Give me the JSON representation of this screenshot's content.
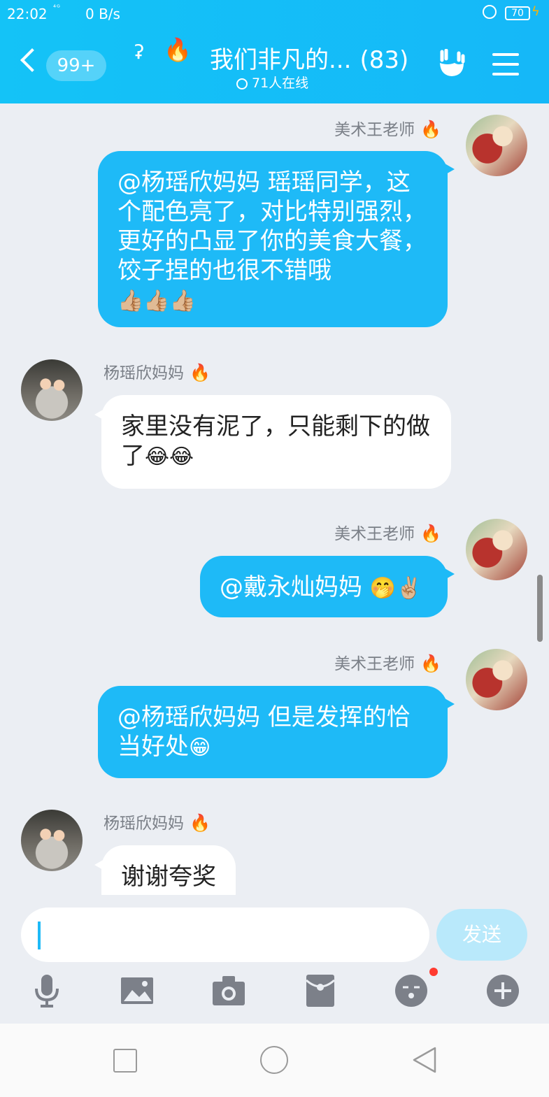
{
  "status_bar": {
    "time": "22:02",
    "signal": "⁴ᴳ",
    "net_speed": "0 B/s",
    "battery": "70"
  },
  "header": {
    "back_badge": "99+",
    "title": "我们非凡的...",
    "member_count": "(83)",
    "online": "71人在线"
  },
  "messages": [
    {
      "sender": "美术王老师",
      "text": "@杨瑶欣妈妈 瑶瑶同学，这个配色亮了，对比特别强烈，更好的凸显了你的美食大餐，饺子捏的也很不错哦",
      "emoji": "👍🏼👍🏼👍🏼"
    },
    {
      "sender": "杨瑶欣妈妈",
      "text": "家里没有泥了，只能剩下的做了",
      "emoji": "😂😂"
    },
    {
      "sender": "美术王老师",
      "text": "@戴永灿妈妈 ",
      "emoji": "🤭✌🏼"
    },
    {
      "sender": "美术王老师",
      "text": "@杨瑶欣妈妈 但是发挥的恰当好处",
      "emoji": "😁"
    },
    {
      "sender": "杨瑶欣妈妈",
      "text": "谢谢夸奖",
      "emoji": ""
    }
  ],
  "input": {
    "value": "",
    "send_label": "发送"
  },
  "icons": {
    "toolbar": [
      "microphone-icon",
      "image-icon",
      "camera-icon",
      "red-packet-icon",
      "emoji-icon",
      "plus-icon"
    ],
    "nav": [
      "recent-apps-icon",
      "home-icon",
      "back-icon"
    ]
  },
  "colors": {
    "accent": "#1ebaf7",
    "header": "#14c3f7",
    "background": "#ebeef3",
    "fire": "#ff4f1f"
  }
}
